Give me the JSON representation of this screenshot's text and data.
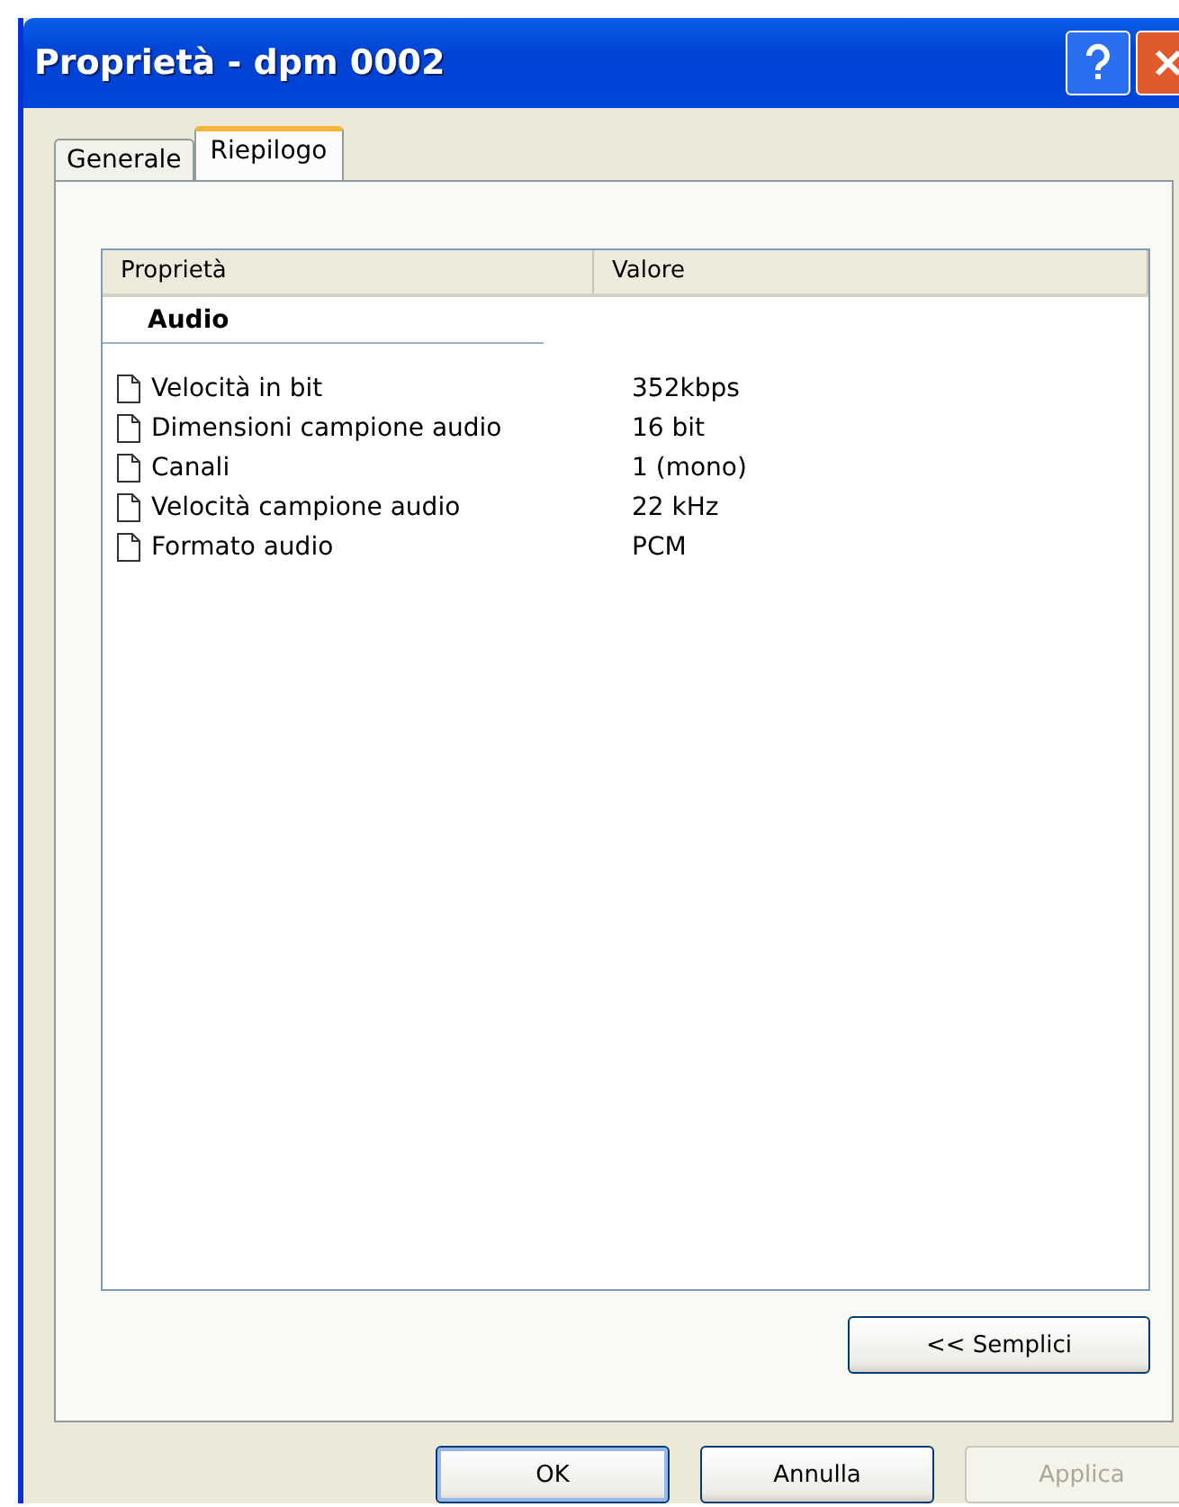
{
  "window": {
    "title": "Proprietà - dpm 0002"
  },
  "tabs": [
    {
      "label": "Generale",
      "selected": false
    },
    {
      "label": "Riepilogo",
      "selected": true
    }
  ],
  "table": {
    "columns": [
      "Proprietà",
      "Valore"
    ],
    "group": "Audio",
    "rows": [
      {
        "property": "Velocità in bit",
        "value": "352kbps"
      },
      {
        "property": "Dimensioni campione audio",
        "value": "16 bit"
      },
      {
        "property": "Canali",
        "value": "1 (mono)"
      },
      {
        "property": "Velocità campione audio",
        "value": "22 kHz"
      },
      {
        "property": "Formato audio",
        "value": "PCM"
      }
    ]
  },
  "toggle_button": {
    "label": "<< Semplici"
  },
  "buttons": [
    {
      "label": "OK",
      "disabled": false,
      "default": true
    },
    {
      "label": "Annulla",
      "disabled": false,
      "default": false
    },
    {
      "label": "Applica",
      "disabled": true,
      "default": false
    }
  ]
}
